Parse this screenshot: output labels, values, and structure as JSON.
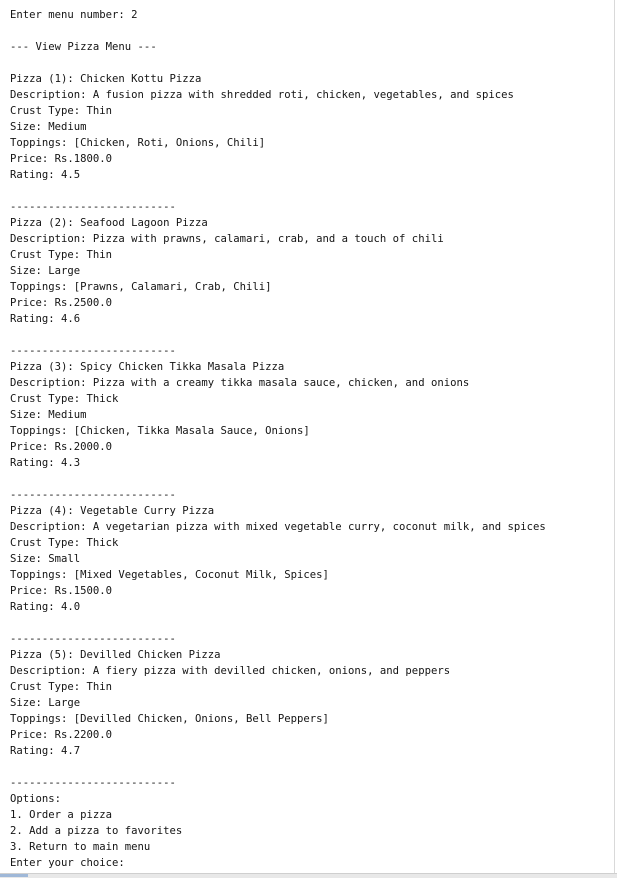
{
  "console": {
    "lines": [
      "Enter menu number: 2",
      "",
      "--- View Pizza Menu ---",
      "",
      "Pizza (1): Chicken Kottu Pizza",
      "Description: A fusion pizza with shredded roti, chicken, vegetables, and spices",
      "Crust Type: Thin",
      "Size: Medium",
      "Toppings: [Chicken, Roti, Onions, Chili]",
      "Price: Rs.1800.0",
      "Rating: 4.5",
      "",
      "--------------------------",
      "Pizza (2): Seafood Lagoon Pizza",
      "Description: Pizza with prawns, calamari, crab, and a touch of chili",
      "Crust Type: Thin",
      "Size: Large",
      "Toppings: [Prawns, Calamari, Crab, Chili]",
      "Price: Rs.2500.0",
      "Rating: 4.6",
      "",
      "--------------------------",
      "Pizza (3): Spicy Chicken Tikka Masala Pizza",
      "Description: Pizza with a creamy tikka masala sauce, chicken, and onions",
      "Crust Type: Thick",
      "Size: Medium",
      "Toppings: [Chicken, Tikka Masala Sauce, Onions]",
      "Price: Rs.2000.0",
      "Rating: 4.3",
      "",
      "--------------------------",
      "Pizza (4): Vegetable Curry Pizza",
      "Description: A vegetarian pizza with mixed vegetable curry, coconut milk, and spices",
      "Crust Type: Thick",
      "Size: Small",
      "Toppings: [Mixed Vegetables, Coconut Milk, Spices]",
      "Price: Rs.1500.0",
      "Rating: 4.0",
      "",
      "--------------------------",
      "Pizza (5): Devilled Chicken Pizza",
      "Description: A fiery pizza with devilled chicken, onions, and peppers",
      "Crust Type: Thin",
      "Size: Large",
      "Toppings: [Devilled Chicken, Onions, Bell Peppers]",
      "Price: Rs.2200.0",
      "Rating: 4.7",
      "",
      "--------------------------",
      "Options:",
      "1. Order a pizza",
      "2. Add a pizza to favorites",
      "3. Return to main menu",
      "Enter your choice: "
    ]
  }
}
